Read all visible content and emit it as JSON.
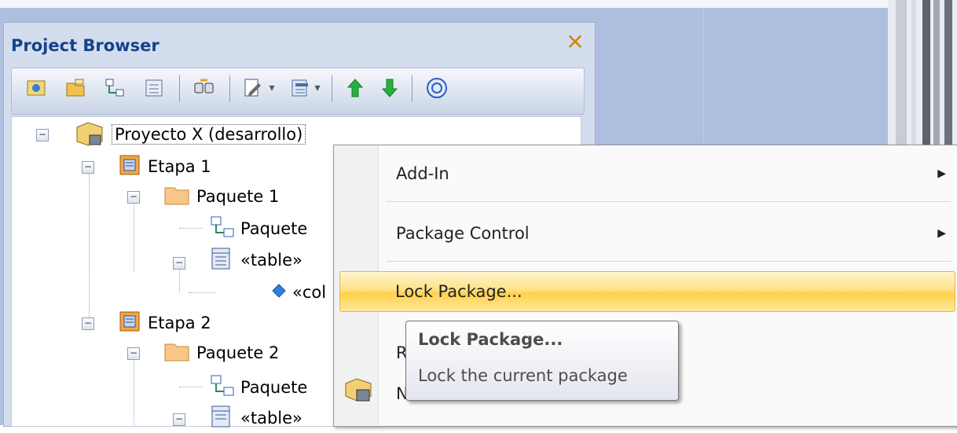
{
  "browser": {
    "title": "Project Browser",
    "close_glyph": "✕",
    "toolbar": [
      {
        "name": "new-model-icon",
        "glyph": "▣",
        "color": "#3a7bd5"
      },
      {
        "name": "new-package-icon",
        "glyph": "▰",
        "color": "#e0a12a"
      },
      {
        "name": "new-diagram-icon",
        "glyph": "⊞",
        "color": "#2e8b57"
      },
      {
        "name": "new-element-icon",
        "glyph": "▤",
        "color": "#6f7f99"
      },
      {
        "name": "find-icon",
        "glyph": "⌕",
        "color": "#3b4a66"
      },
      {
        "name": "edit-properties-icon",
        "glyph": "✎",
        "color": "#444"
      },
      {
        "name": "dropdown-icon",
        "glyph": "▾",
        "color": "#555"
      },
      {
        "name": "documentation-icon",
        "glyph": "▦",
        "color": "#4a6ea8"
      },
      {
        "name": "dropdown-icon",
        "glyph": "▾",
        "color": "#555"
      },
      {
        "name": "move-up-icon",
        "glyph": "↑",
        "color": "#1ea33a"
      },
      {
        "name": "move-down-icon",
        "glyph": "↓",
        "color": "#1ea33a"
      },
      {
        "name": "help-icon",
        "glyph": "◎",
        "color": "#2c5fb7"
      }
    ],
    "tree": [
      {
        "label": "Proyecto X (desarrollo)",
        "icon": "model-root-icon"
      },
      {
        "label": "Etapa 1",
        "icon": "view-icon"
      },
      {
        "label": "Paquete 1",
        "icon": "package-folder-icon"
      },
      {
        "label": "Paquete",
        "icon": "diagram-icon"
      },
      {
        "label": "«table» ",
        "icon": "table-icon"
      },
      {
        "label": "«col",
        "icon": "column-icon"
      },
      {
        "label": "Etapa 2",
        "icon": "view-icon"
      },
      {
        "label": "Paquete 2",
        "icon": "package-folder-icon"
      },
      {
        "label": "Paquete",
        "icon": "diagram-icon"
      },
      {
        "label": "«table» ",
        "icon": "table-icon"
      }
    ]
  },
  "context_menu": {
    "items": [
      {
        "label": "Add-In",
        "submenu": true
      },
      {
        "label": "Package Control",
        "submenu": true
      },
      {
        "label": "Lock Package...",
        "highlighted": true
      },
      {
        "label": "R",
        "partial": true
      },
      {
        "label": "N",
        "partial": true
      }
    ],
    "submenu_arrow": "▶"
  },
  "tooltip": {
    "title": "Lock Package...",
    "description": "Lock the current package"
  },
  "colors": {
    "canvas": "#aebfe0",
    "highlight": "#ffd24d",
    "title_text": "#15428b"
  }
}
